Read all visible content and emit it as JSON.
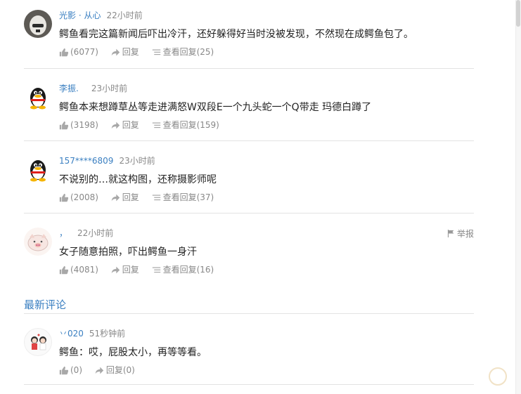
{
  "comments": [
    {
      "user": "光影 · 从心",
      "time": "22小时前",
      "text": "鳄鱼看完这篇新闻后吓出冷汗，还好躲得好当时没被发现，不然现在成鳄鱼包了。",
      "likes": "(6077)",
      "reply_label": "回复",
      "view_replies": "查看回复(25)"
    },
    {
      "user": "李振.",
      "time": "23小时前",
      "text": "鳄鱼本来想蹲草丛等走进满怒W双段E一个九头蛇一个Q带走 玛德白蹲了",
      "likes": "(3198)",
      "reply_label": "回复",
      "view_replies": "查看回复(159)"
    },
    {
      "user": "157****6809",
      "time": "23小时前",
      "text": "不说别的…就这构图，还称摄影师呢",
      "likes": "(2008)",
      "reply_label": "回复",
      "view_replies": "查看回复(37)"
    },
    {
      "user": "，",
      "time": "22小时前",
      "text": "女子随意拍照，吓出鳄鱼一身汗",
      "likes": "(4081)",
      "reply_label": "回复",
      "view_replies": "查看回复(16)",
      "report_label": "举报"
    }
  ],
  "latest_title": "最新评论",
  "latest": [
    {
      "user": "丷020",
      "time": "51秒钟前",
      "text": "鳄鱼：哎，屁股太小，再等等看。",
      "likes": "(0)",
      "reply_label": "回复(0)"
    }
  ],
  "icons": {
    "like": "thumbs-up-icon",
    "reply": "share-arrow-icon",
    "view": "list-icon",
    "report": "flag-icon"
  },
  "colors": {
    "link": "#3a7fc1",
    "muted": "#888888",
    "divider": "#e3e3e3"
  }
}
